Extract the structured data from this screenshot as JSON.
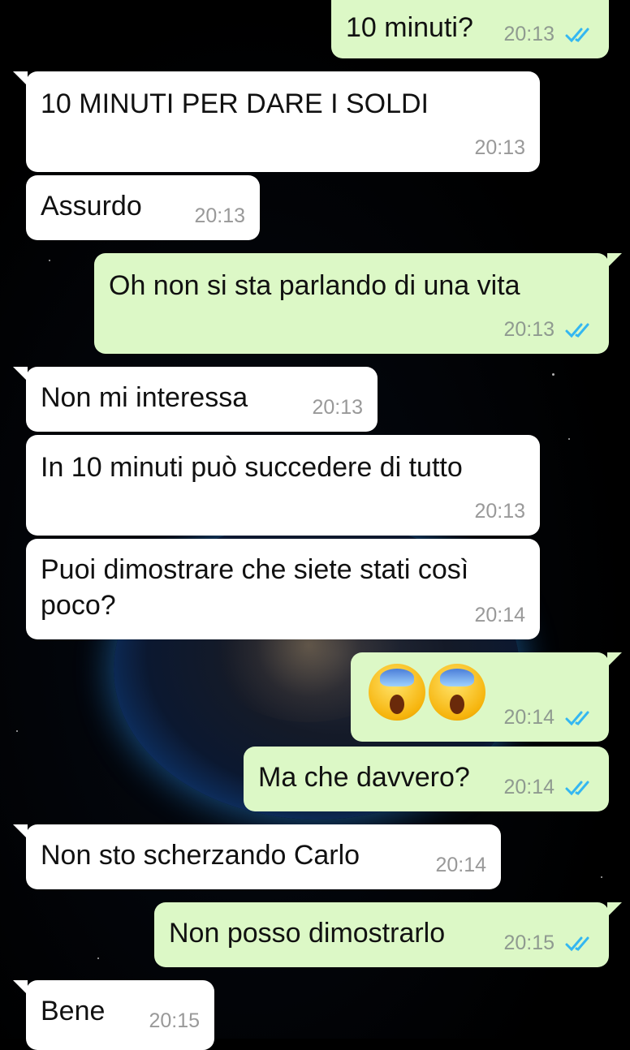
{
  "chat": {
    "messages": [
      {
        "dir": "out",
        "text": "10 minuti?",
        "time": "20:13",
        "status": "read"
      },
      {
        "dir": "in",
        "text": "10 MINUTI PER DARE I SOLDI",
        "time": "20:13"
      },
      {
        "dir": "in",
        "text": "Assurdo",
        "time": "20:13"
      },
      {
        "dir": "out",
        "text": "Oh non si sta parlando di una vita",
        "time": "20:13",
        "status": "read"
      },
      {
        "dir": "in",
        "text": "Non mi interessa",
        "time": "20:13"
      },
      {
        "dir": "in",
        "text": "In 10 minuti può succedere di tutto",
        "time": "20:13"
      },
      {
        "dir": "in",
        "text": "Puoi dimostrare che siete stati così poco?",
        "time": "20:14"
      },
      {
        "dir": "out",
        "emoji": "face-screaming-in-fear",
        "emoji_count": 2,
        "time": "20:14",
        "status": "read"
      },
      {
        "dir": "out",
        "text": "Ma che davvero?",
        "time": "20:14",
        "status": "read"
      },
      {
        "dir": "in",
        "text": "Non sto scherzando Carlo",
        "time": "20:14"
      },
      {
        "dir": "out",
        "text": "Non posso dimostrarlo",
        "time": "20:15",
        "status": "read"
      },
      {
        "dir": "in",
        "text": "Bene",
        "time": "20:15"
      }
    ]
  },
  "colors": {
    "incoming_bubble": "#ffffff",
    "outgoing_bubble": "#dcf8c6",
    "read_ticks": "#34b7f1",
    "timestamp": "#999999"
  },
  "icons": {
    "read_receipt": "double-check-icon",
    "emoji": "face-screaming-in-fear-icon"
  }
}
